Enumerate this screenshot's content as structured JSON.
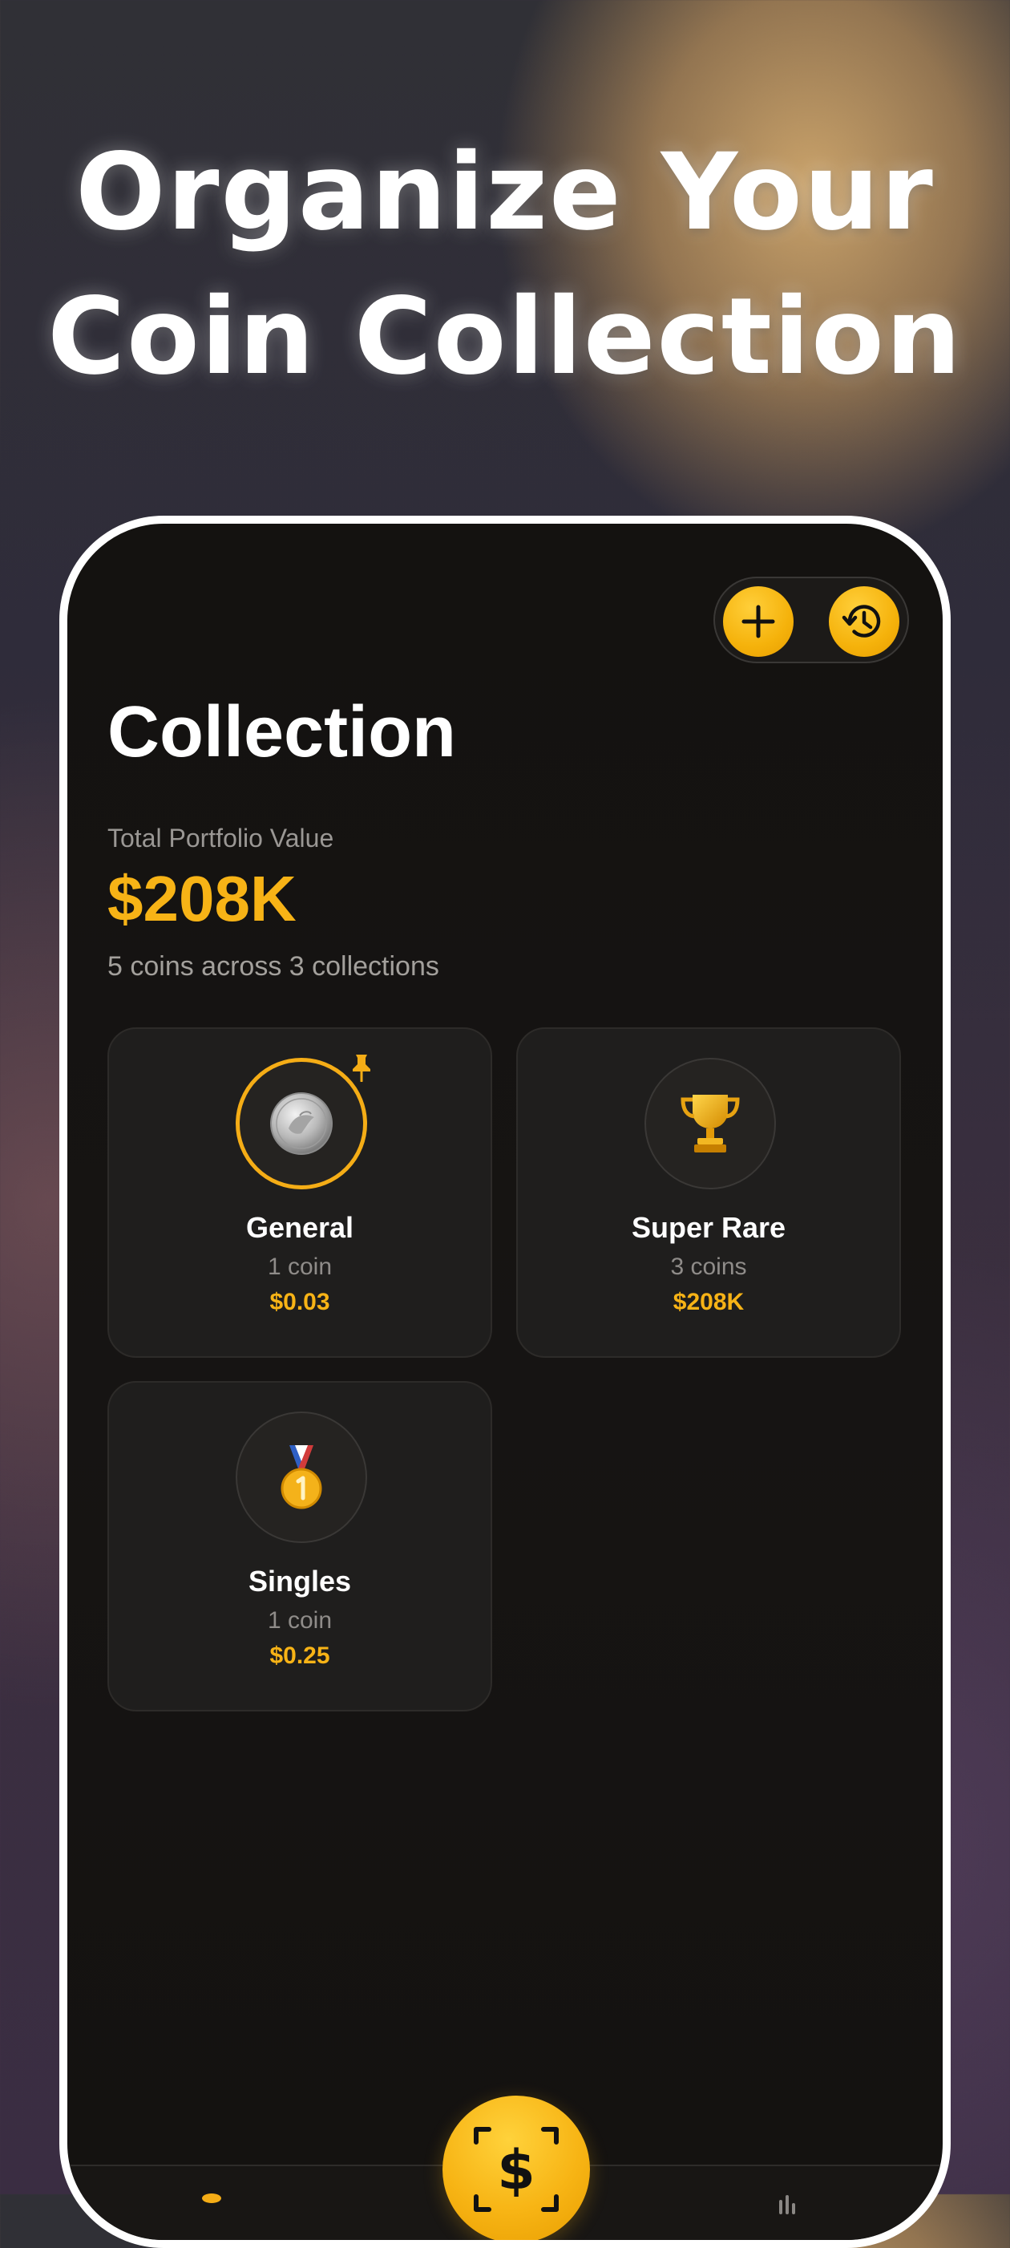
{
  "headline": {
    "line1": "Organize Your",
    "line2": "Coin Collection"
  },
  "toolbar": {
    "add_icon": "plus-icon",
    "history_icon": "history-icon",
    "accent_color": "#F7B316"
  },
  "screen": {
    "title": "Collection",
    "portfolio": {
      "label": "Total Portfolio Value",
      "value": "$208K",
      "summary": "5 coins across 3 collections"
    }
  },
  "collections": [
    {
      "name": "General",
      "count": "1 coin",
      "value": "$0.03",
      "icon": "silver-coin-icon",
      "pinned": true
    },
    {
      "name": "Super Rare",
      "count": "3 coins",
      "value": "$208K",
      "icon": "trophy-icon",
      "pinned": false
    },
    {
      "name": "Singles",
      "count": "1 coin",
      "value": "$0.25",
      "icon": "first-place-medal-icon",
      "pinned": false
    }
  ],
  "tabbar": {
    "center_button_icon": "scan-dollar-icon"
  }
}
